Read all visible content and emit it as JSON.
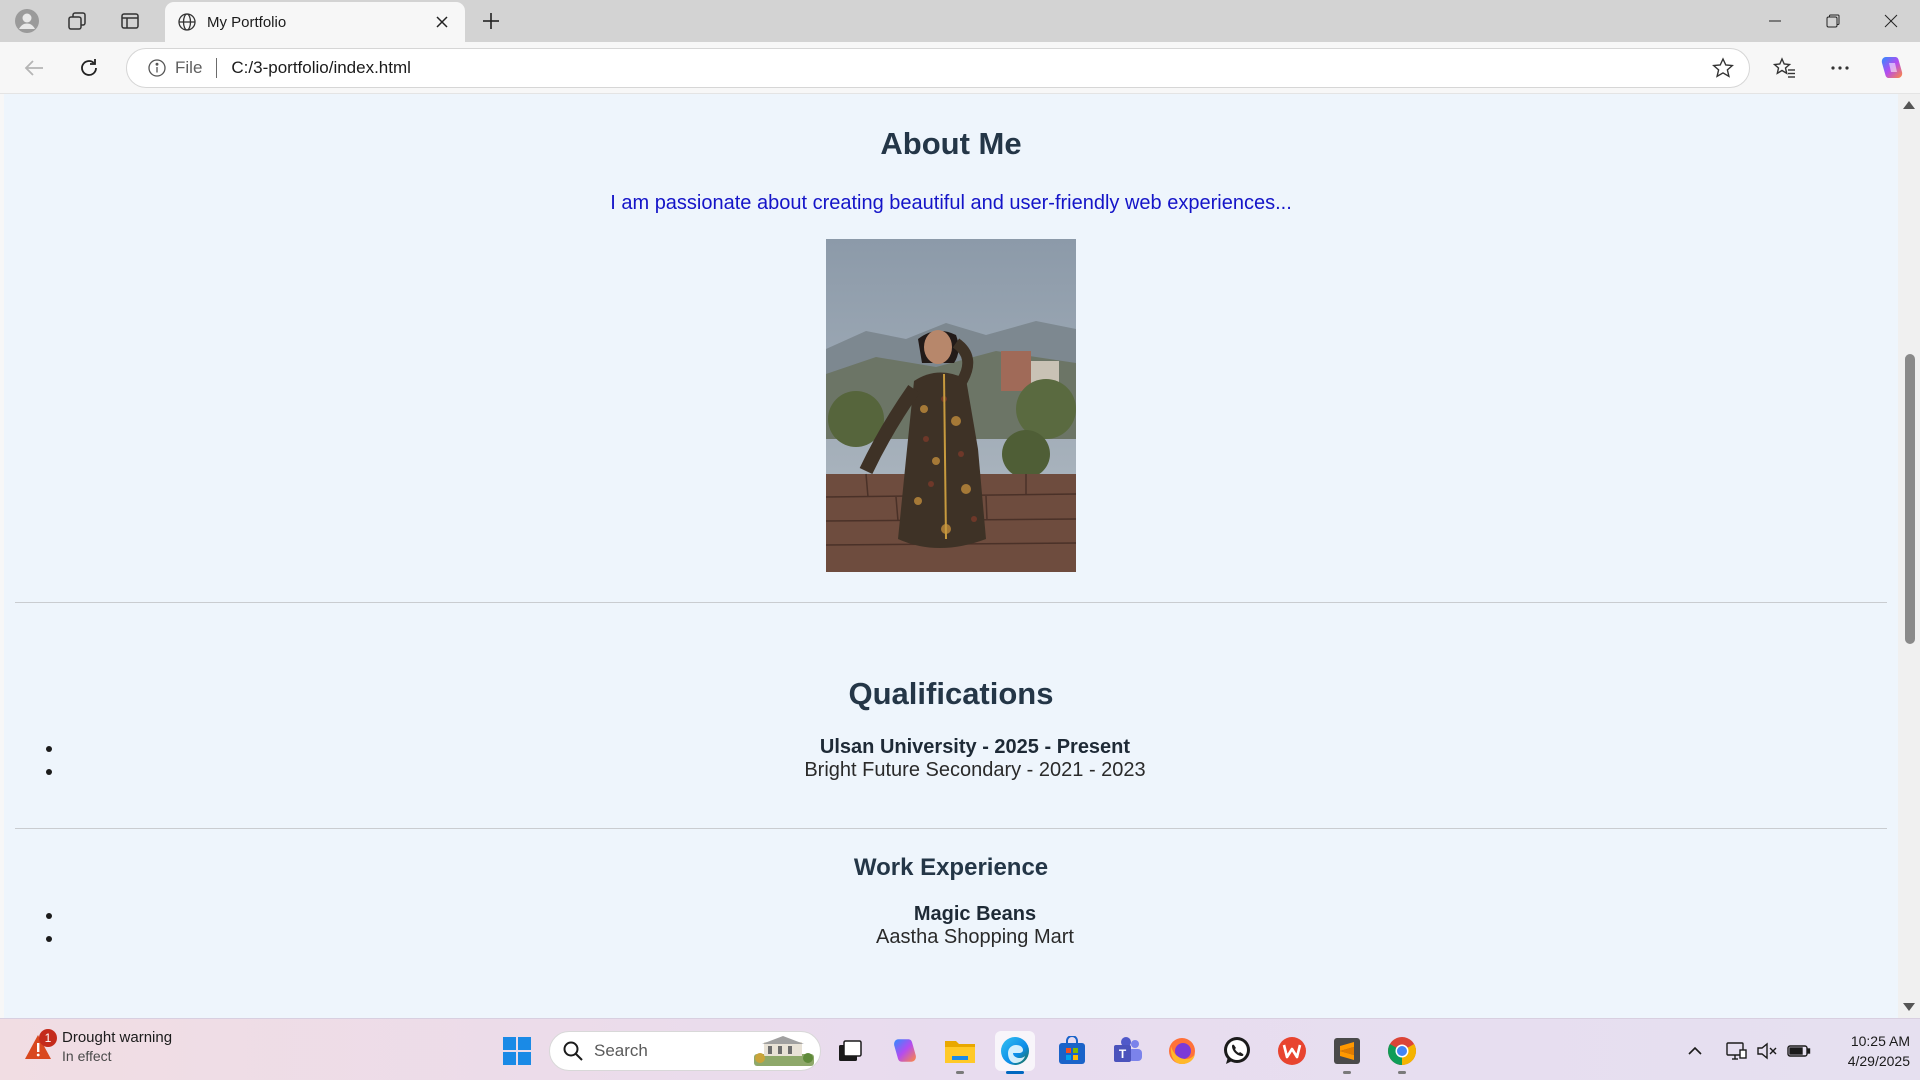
{
  "browser": {
    "tab_title": "My Portfolio",
    "address_scheme": "File",
    "address_url": "C:/3-portfolio/index.html"
  },
  "page": {
    "about_heading": "About Me",
    "about_text": "I am passionate about creating beautiful and user-friendly web experiences...",
    "photo_alt": "Profile photo",
    "qualifications_heading": "Qualifications",
    "qualifications": [
      "Ulsan University - 2025 - Present",
      "Bright Future Secondary - 2021 - 2023"
    ],
    "work_heading": "Work Experience",
    "work": [
      "Magic Beans",
      "Aastha Shopping Mart"
    ]
  },
  "taskbar": {
    "weather_title": "Drought warning",
    "weather_subtitle": "In effect",
    "weather_badge": "1",
    "search_label": "Search",
    "time": "10:25 AM",
    "date": "4/29/2025"
  },
  "colors": {
    "page_background": "#eef5fc",
    "heading": "#243647",
    "about_text": "#1414c8",
    "accent": "#0067c0"
  },
  "icons": [
    "profile-icon",
    "workspaces-icon",
    "tab-actions-icon",
    "globe-icon",
    "close-icon",
    "new-tab-icon",
    "minimize-icon",
    "restore-icon",
    "window-close-icon",
    "back-icon",
    "refresh-icon",
    "info-icon",
    "star-icon",
    "favorites-icon",
    "more-icon",
    "copilot-icon",
    "windows-start-icon",
    "search-icon",
    "task-view-icon",
    "copilot-app-icon",
    "file-explorer-icon",
    "edge-icon",
    "store-icon",
    "teams-icon",
    "firefox-icon",
    "whatsapp-icon",
    "wps-office-icon",
    "sublime-text-icon",
    "chrome-icon",
    "chevron-up-icon",
    "network-icon",
    "volume-muted-icon",
    "battery-icon"
  ]
}
